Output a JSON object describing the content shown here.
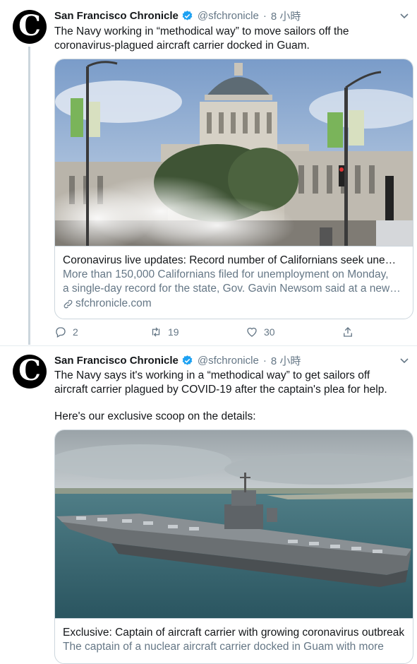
{
  "tweets": [
    {
      "author": "San Francisco Chronicle",
      "handle": "@sfchronicle",
      "sep": "·",
      "time": "8 小時",
      "text_lines": [
        "The Navy working in “methodical way” to move sailors off the",
        "coronavirus-plagued aircraft carrier docked in Guam."
      ],
      "card": {
        "title": "Coronavirus live updates: Record number of Californians seek unemployment",
        "desc_lines": [
          "More than 150,000 Californians filed for unemployment on Monday,",
          "a single-day record for the state, Gov. Gavin Newsom said at a news briefing"
        ],
        "domain": "sfchronicle.com"
      },
      "actions": {
        "replies": "2",
        "retweets": "19",
        "likes": "30"
      }
    },
    {
      "author": "San Francisco Chronicle",
      "handle": "@sfchronicle",
      "sep": "·",
      "time": "8 小時",
      "text_lines": [
        "The Navy says it's working in a “methodical way” to get sailors off",
        "aircraft carrier plagued by COVID-19 after the captain's plea for help."
      ],
      "text_extra": "Here's our exclusive scoop on the details:",
      "card": {
        "title": "Exclusive: Captain of aircraft carrier with growing coronavirus outbreak",
        "desc_lines": [
          "The captain of a nuclear aircraft carrier docked in Guam with more"
        ]
      }
    }
  ],
  "avatar_letter": "C",
  "colors": {
    "accent": "#1da1f2",
    "muted": "#657786",
    "border": "#ccd6dd"
  }
}
